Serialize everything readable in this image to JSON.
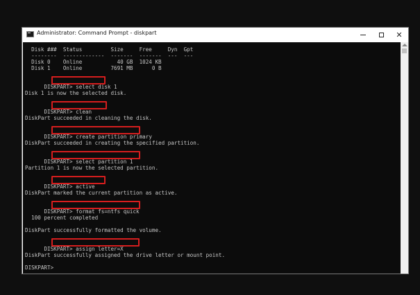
{
  "window": {
    "title": "Administrator: Command Prompt - diskpart"
  },
  "icons": {
    "app": "cmd-icon",
    "minimize": "minimize-icon",
    "maximize": "maximize-icon",
    "close": "close-icon",
    "scroll_up": "scroll-up-arrow-icon"
  },
  "colors": {
    "console_bg": "#0c0c0c",
    "console_text": "#c8c8c8",
    "highlight": "#d71e1e"
  },
  "console": {
    "table": {
      "header": "  Disk ###  Status         Size     Free     Dyn  Gpt",
      "separator": "  --------  -------------  -------  -------  ---  ---",
      "row0": "  Disk 0    Online           40 GB  1024 KB",
      "row1": "  Disk 1    Online         7691 MB      0 B"
    },
    "prompt": "DISKPART>",
    "commands": [
      "select disk 1",
      "clean",
      "create partition primary",
      "select partition 1",
      "active",
      "format fs=ntfs quick",
      "assign letter=X"
    ],
    "responses": [
      "Disk 1 is now the selected disk.",
      "DiskPart succeeded in cleaning the disk.",
      "DiskPart succeeded in creating the specified partition.",
      "Partition 1 is now the selected partition.",
      "DiskPart marked the current partition as active.",
      "  100 percent completed",
      "DiskPart successfully formatted the volume.",
      "DiskPart successfully assigned the drive letter or mount point."
    ]
  }
}
